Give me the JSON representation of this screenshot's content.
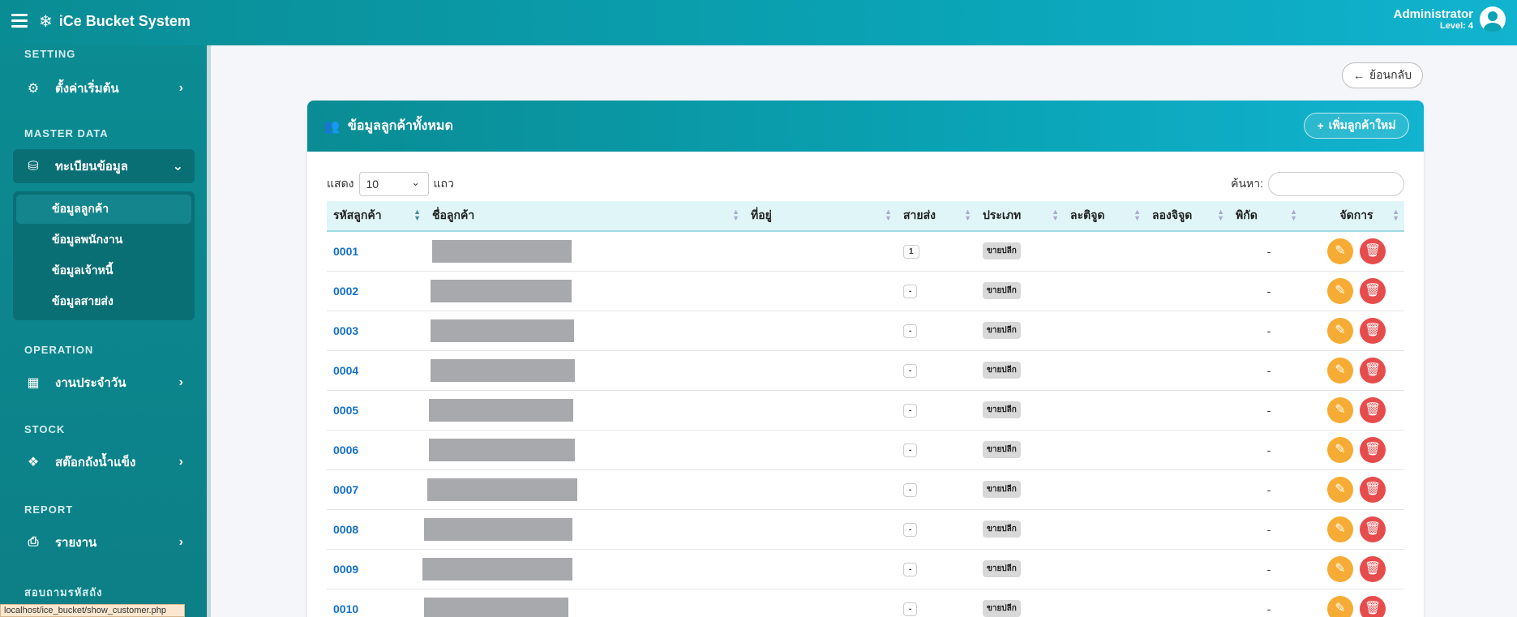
{
  "header": {
    "brand": "iCe Bucket System",
    "brand_icon": "snowflake-icon",
    "user_name": "Administrator",
    "user_level": "Level: 4"
  },
  "sidebar": {
    "sections": [
      {
        "title": "SETTING"
      },
      {
        "title": "MASTER DATA"
      },
      {
        "title": "OPERATION"
      },
      {
        "title": "STOCK"
      },
      {
        "title": "REPORT"
      },
      {
        "title": "สอบถามรหัสถัง"
      }
    ],
    "items": [
      {
        "label": "ตั้งค่าเริ่มต้น",
        "icon": "gears-icon"
      },
      {
        "label": "ทะเบียนข้อมูล",
        "icon": "database-icon"
      },
      {
        "label": "งานประจำวัน",
        "icon": "calendar-check-icon"
      },
      {
        "label": "สต๊อกถังน้ำแข็ง",
        "icon": "cubes-icon"
      },
      {
        "label": "รายงาน",
        "icon": "printer-icon"
      }
    ],
    "submenu": [
      {
        "label": "ข้อมูลลูกค้า"
      },
      {
        "label": "ข้อมูลพนักงาน"
      },
      {
        "label": "ข้อมูลเจ้าหนี้"
      },
      {
        "label": "ข้อมูลสายส่ง"
      }
    ],
    "status_url": "localhost/ice_bucket/show_customer.php"
  },
  "main": {
    "back_label": "ย้อนกลับ",
    "card_title": "ข้อมูลลูกค้าทั้งหมด",
    "add_label": "เพิ่มลูกค้าใหม่",
    "show_label": "แสดง",
    "length_value": "10",
    "rows_label": "แถว",
    "search_label": "ค้นหา:",
    "columns": [
      "รหัสลูกค้า",
      "ชื่อลูกค้า",
      "ที่อยู่",
      "สายส่ง",
      "ประเภท",
      "ละติจูด",
      "ลองจิจูด",
      "พิกัด",
      "จัดการ"
    ],
    "rows": [
      {
        "code": "0001",
        "route": "1",
        "type": "ขายปลีก",
        "coord": "-"
      },
      {
        "code": "0002",
        "route": "-",
        "type": "ขายปลีก",
        "coord": "-"
      },
      {
        "code": "0003",
        "route": "-",
        "type": "ขายปลีก",
        "coord": "-"
      },
      {
        "code": "0004",
        "route": "-",
        "type": "ขายปลีก",
        "coord": "-"
      },
      {
        "code": "0005",
        "route": "-",
        "type": "ขายปลีก",
        "coord": "-"
      },
      {
        "code": "0006",
        "route": "-",
        "type": "ขายปลีก",
        "coord": "-"
      },
      {
        "code": "0007",
        "route": "-",
        "type": "ขายปลีก",
        "coord": "-"
      },
      {
        "code": "0008",
        "route": "-",
        "type": "ขายปลีก",
        "coord": "-"
      },
      {
        "code": "0009",
        "route": "-",
        "type": "ขายปลีก",
        "coord": "-"
      },
      {
        "code": "0010",
        "route": "-",
        "type": "ขายปลีก",
        "coord": "-"
      }
    ]
  }
}
